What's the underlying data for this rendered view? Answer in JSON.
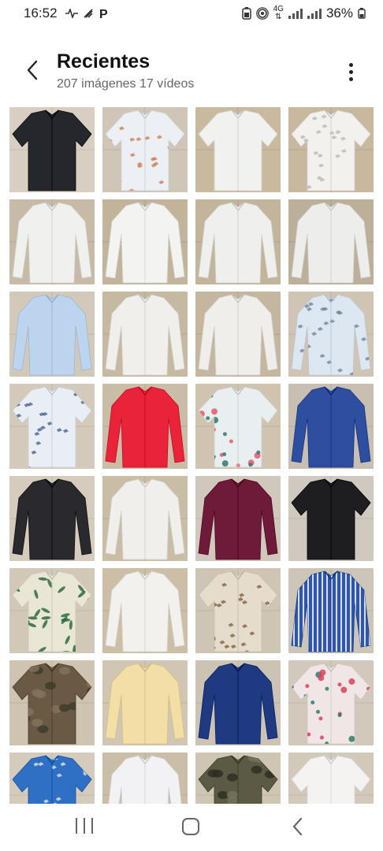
{
  "status_bar": {
    "time": "16:52",
    "left_icons": [
      "activity-icon",
      "signal-slash-icon",
      "parking-icon"
    ],
    "right_icons": [
      "battery-saver-icon",
      "hotspot-icon",
      "network-4g-icon",
      "signal-icon",
      "signal-icon"
    ],
    "network_label": "4G",
    "battery": "36%"
  },
  "header": {
    "title": "Recientes",
    "subtitle": "207 imágenes 17 vídeos"
  },
  "grid": {
    "thumbnails": [
      {
        "bg": "#d8cfc2",
        "shirt": "#26272c",
        "pattern": "none",
        "accent": "#26272c",
        "sleeves": "short"
      },
      {
        "bg": "#cfc6b8",
        "shirt": "#eceff3",
        "pattern": "print",
        "accent": "#cc7a4a",
        "sleeves": "short"
      },
      {
        "bg": "#c9b99f",
        "shirt": "#f1f1ef",
        "pattern": "none",
        "accent": "#f1f1ef",
        "sleeves": "short"
      },
      {
        "bg": "#c8b89d",
        "shirt": "#f2f1ee",
        "pattern": "print",
        "accent": "#b6b6b0",
        "sleeves": "short"
      },
      {
        "bg": "#c7bba7",
        "shirt": "#f0f0ee",
        "pattern": "none",
        "accent": "#f0f0ee",
        "sleeves": "long"
      },
      {
        "bg": "#c2b49b",
        "shirt": "#f3f3f1",
        "pattern": "none",
        "accent": "#f3f3f1",
        "sleeves": "long"
      },
      {
        "bg": "#c2b59c",
        "shirt": "#efefed",
        "pattern": "none",
        "accent": "#4a5a8a",
        "sleeves": "long"
      },
      {
        "bg": "#bdb09a",
        "shirt": "#ededeb",
        "pattern": "none",
        "accent": "#2c3550",
        "sleeves": "long"
      },
      {
        "bg": "#d2c9bb",
        "shirt": "#bcd4ee",
        "pattern": "none",
        "accent": "#bcd4ee",
        "sleeves": "long"
      },
      {
        "bg": "#c6b9a2",
        "shirt": "#f0efec",
        "pattern": "none",
        "accent": "#f0efec",
        "sleeves": "long"
      },
      {
        "bg": "#c4b69f",
        "shirt": "#efeeeb",
        "pattern": "none",
        "accent": "#efeeeb",
        "sleeves": "long"
      },
      {
        "bg": "#d0c5b4",
        "shirt": "#dde7f2",
        "pattern": "print",
        "accent": "#6b7d96",
        "sleeves": "long"
      },
      {
        "bg": "#d3cabb",
        "shirt": "#e9eef5",
        "pattern": "print",
        "accent": "#3d5a8c",
        "sleeves": "short"
      },
      {
        "bg": "#c9bda8",
        "shirt": "#e8233a",
        "pattern": "none",
        "accent": "#e8233a",
        "sleeves": "long"
      },
      {
        "bg": "#d0c4b1",
        "shirt": "#e9eef0",
        "pattern": "floral",
        "accent": "#e45a6a",
        "sleeves": "short"
      },
      {
        "bg": "#c8bfb2",
        "shirt": "#2e4fa0",
        "pattern": "none",
        "accent": "#2e4fa0",
        "sleeves": "long"
      },
      {
        "bg": "#d5ccbe",
        "shirt": "#2a2a2e",
        "pattern": "none",
        "accent": "#2a2a2e",
        "sleeves": "long"
      },
      {
        "bg": "#cabda6",
        "shirt": "#f0efec",
        "pattern": "none",
        "accent": "#f0efec",
        "sleeves": "long"
      },
      {
        "bg": "#d0c8bc",
        "shirt": "#6e1b3a",
        "pattern": "none",
        "accent": "#6e1b3a",
        "sleeves": "long"
      },
      {
        "bg": "#cfc9c0",
        "shirt": "#1e1e21",
        "pattern": "none",
        "accent": "#1e1e21",
        "sleeves": "short"
      },
      {
        "bg": "#d2c8b8",
        "shirt": "#e9e6d6",
        "pattern": "leaf",
        "accent": "#2f6b3c",
        "sleeves": "short"
      },
      {
        "bg": "#cdbfa7",
        "shirt": "#f2f1ee",
        "pattern": "none",
        "accent": "#f2f1ee",
        "sleeves": "long"
      },
      {
        "bg": "#cfc5b4",
        "shirt": "#e6dccb",
        "pattern": "print",
        "accent": "#7b5a3a",
        "sleeves": "short"
      },
      {
        "bg": "#cdc5b8",
        "shirt": "#2f56a8",
        "pattern": "stripe",
        "accent": "#ffffff",
        "sleeves": "long"
      },
      {
        "bg": "#cfc4b2",
        "shirt": "#6a5a45",
        "pattern": "camo",
        "accent": "#3d3a2a",
        "sleeves": "short"
      },
      {
        "bg": "#d0c6b3",
        "shirt": "#f3dfa6",
        "pattern": "none",
        "accent": "#f3dfa6",
        "sleeves": "long"
      },
      {
        "bg": "#ccc3b5",
        "shirt": "#1f3a80",
        "pattern": "none",
        "accent": "#1f3a80",
        "sleeves": "long"
      },
      {
        "bg": "#d2c9bc",
        "shirt": "#f1e6e6",
        "pattern": "floral",
        "accent": "#d8415a",
        "sleeves": "short"
      },
      {
        "bg": "#d4cbbd",
        "shirt": "#2f6fc4",
        "pattern": "print",
        "accent": "#e9edf2",
        "sleeves": "short"
      },
      {
        "bg": "#cbbea8",
        "shirt": "#f2f2f4",
        "pattern": "none",
        "accent": "#f2f2f4",
        "sleeves": "long"
      },
      {
        "bg": "#cfc5b3",
        "shirt": "#5b5a45",
        "pattern": "camo",
        "accent": "#2d2c22",
        "sleeves": "short"
      },
      {
        "bg": "#d2c9bb",
        "shirt": "#f4f3f1",
        "pattern": "none",
        "accent": "#f4f3f1",
        "sleeves": "short"
      }
    ]
  },
  "nav_bar": {
    "icons": [
      "recent-apps-icon",
      "home-icon",
      "back-icon"
    ]
  }
}
